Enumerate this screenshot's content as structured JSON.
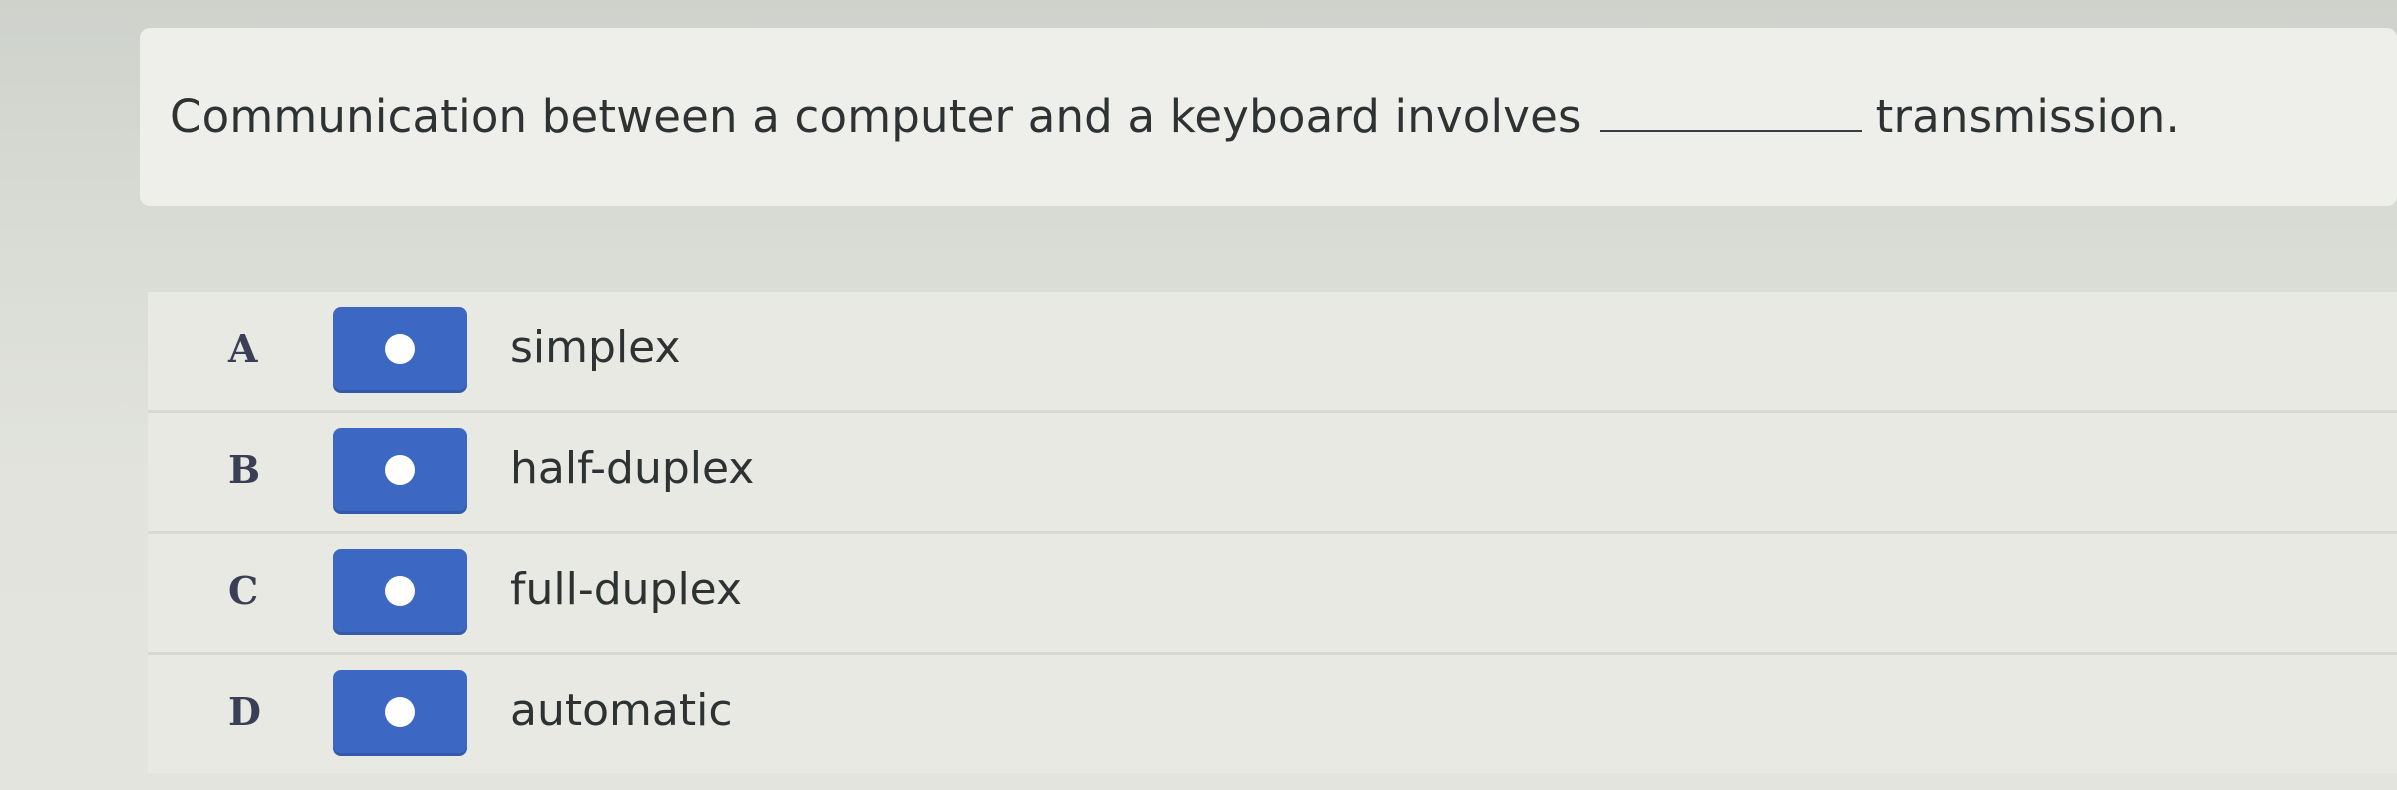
{
  "question": {
    "text_before": "Communication between a computer and a keyboard involves",
    "text_after": "transmission."
  },
  "options": [
    {
      "letter": "A",
      "label": "simplex"
    },
    {
      "letter": "B",
      "label": "half-duplex"
    },
    {
      "letter": "C",
      "label": "full-duplex"
    },
    {
      "letter": "D",
      "label": "automatic"
    }
  ],
  "colors": {
    "radio_button": "#3c67c2",
    "radio_dot": "#ffffff",
    "text": "#2f3232"
  }
}
